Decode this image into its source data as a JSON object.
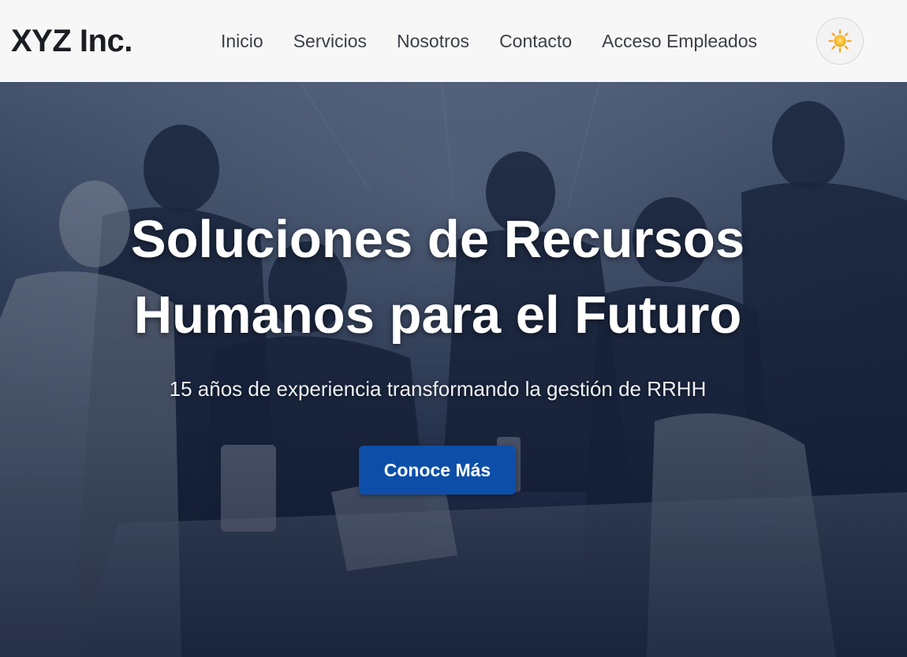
{
  "header": {
    "logo": "XYZ Inc.",
    "nav": [
      {
        "label": "Inicio"
      },
      {
        "label": "Servicios"
      },
      {
        "label": "Nosotros"
      },
      {
        "label": "Contacto"
      },
      {
        "label": "Acceso Empleados"
      }
    ],
    "theme_toggle_icon": "sun-icon"
  },
  "hero": {
    "title_line1": "Soluciones de Recursos",
    "title_line2": "Humanos para el Futuro",
    "subtitle": "15 años de experiencia transformando la gestión de RRHH",
    "cta_label": "Conoce Más",
    "background_image": "office-team-meeting-photo"
  },
  "colors": {
    "header_bg": "#f7f7f8",
    "logo_text": "#1b1d22",
    "nav_text": "#3c3f45",
    "cta_bg": "#0d4fa8",
    "hero_overlay": "#14203a",
    "sun": "#f5b323"
  }
}
